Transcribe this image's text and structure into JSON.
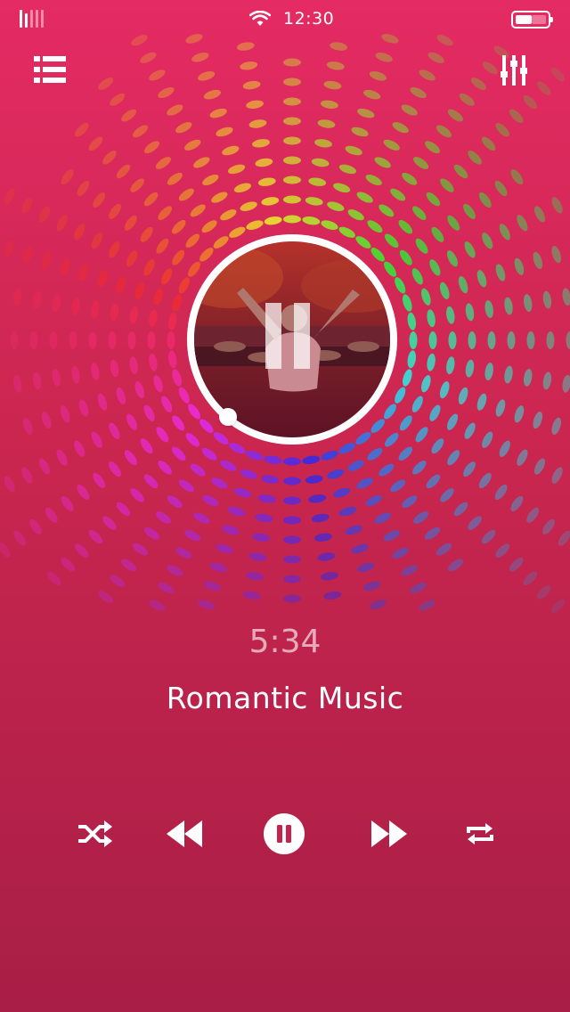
{
  "status": {
    "time": "12:30",
    "signal_bars_active": 2,
    "signal_bars_total": 5,
    "battery_level": 0.5
  },
  "icons": {
    "playlist": "list-icon",
    "equalizer": "equalizer-icon",
    "wifi": "wifi-icon",
    "shuffle": "shuffle-icon",
    "previous": "rewind-icon",
    "play_pause": "pause-icon",
    "next": "fast-forward-icon",
    "repeat": "repeat-icon"
  },
  "player": {
    "duration": "5:34",
    "track_title": "Romantic Music",
    "is_playing": true
  },
  "colors": {
    "background_top": "#e42b63",
    "background_bottom": "#a81e46",
    "accent": "#ffffff"
  }
}
